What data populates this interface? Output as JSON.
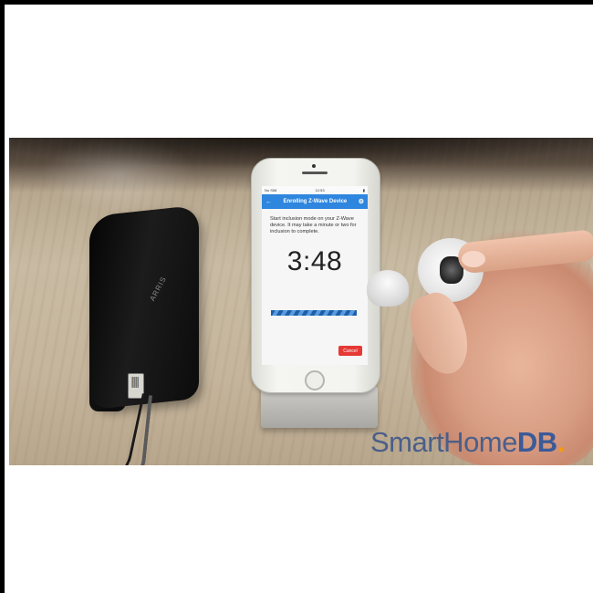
{
  "phone_screen": {
    "status_carrier": "No SIM",
    "status_time": "12:53",
    "header_title": "Enrolling Z-Wave Device",
    "instruction": "Start inclusion mode on your Z-Wave device. It may take a minute or two for inclusion to complete.",
    "timer": "3:48",
    "progress": 1.0,
    "cancel_label": "Cancel",
    "accent_color": "#2e86de",
    "cancel_color": "#e53935"
  },
  "router": {
    "logo_text": "ARRIS"
  },
  "watermark": {
    "part_a": "SmartHome",
    "part_b": "DB",
    "dot": "."
  },
  "icons": [
    "back-arrow-icon",
    "gear-icon",
    "battery-icon"
  ]
}
